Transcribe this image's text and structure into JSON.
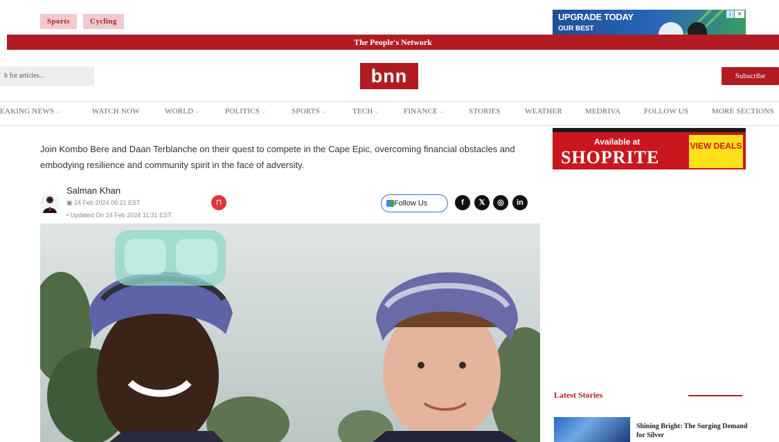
{
  "tags": [
    "Sports",
    "Cycling"
  ],
  "top_ad": {
    "headline": "UPGRADE TODAY",
    "sub": "OUR BEST"
  },
  "network_banner": "The People's Network",
  "search": {
    "placeholder": "h for articles..."
  },
  "logo": "bnn",
  "subscribe_label": "Subscribe",
  "nav": [
    {
      "label": "EAKING NEWS",
      "dropdown": true
    },
    {
      "label": "WATCH NOW",
      "dropdown": false
    },
    {
      "label": "WORLD",
      "dropdown": true
    },
    {
      "label": "POLITICS",
      "dropdown": true
    },
    {
      "label": "SPORTS",
      "dropdown": true
    },
    {
      "label": "TECH",
      "dropdown": true
    },
    {
      "label": "FINANCE",
      "dropdown": true
    },
    {
      "label": "STORIES",
      "dropdown": false
    },
    {
      "label": "WEATHER",
      "dropdown": false
    },
    {
      "label": "MEDRIVA",
      "dropdown": false
    },
    {
      "label": "FOLLOW US",
      "dropdown": false
    },
    {
      "label": "MORE SECTIONS",
      "dropdown": false
    }
  ],
  "side_ad": {
    "available": "Available at",
    "store": "SHOPRITE",
    "cta": "VIEW DEALS"
  },
  "article": {
    "description": "Join Kombo Bere and Daan Terblanche on their quest to compete in the Cape Epic, overcoming financial obstacles and embodying resilience and community spirit in the face of adversity.",
    "author": "Salman Khan",
    "date": "24 Feb 2024 06:21 EST",
    "updated": "Updated On 24 Feb 2024 11:31 EST",
    "follow_label": "Follow Us"
  },
  "social_icons": [
    "facebook-icon",
    "x-icon",
    "whatsapp-icon",
    "linkedin-icon"
  ],
  "sidebar": {
    "latest_heading": "Latest Stories",
    "story_title": "Shining Bright: The Surging Demand for Silver"
  },
  "colors": {
    "brand_red": "#b01c22",
    "tag_bg": "#f2c9cc"
  }
}
